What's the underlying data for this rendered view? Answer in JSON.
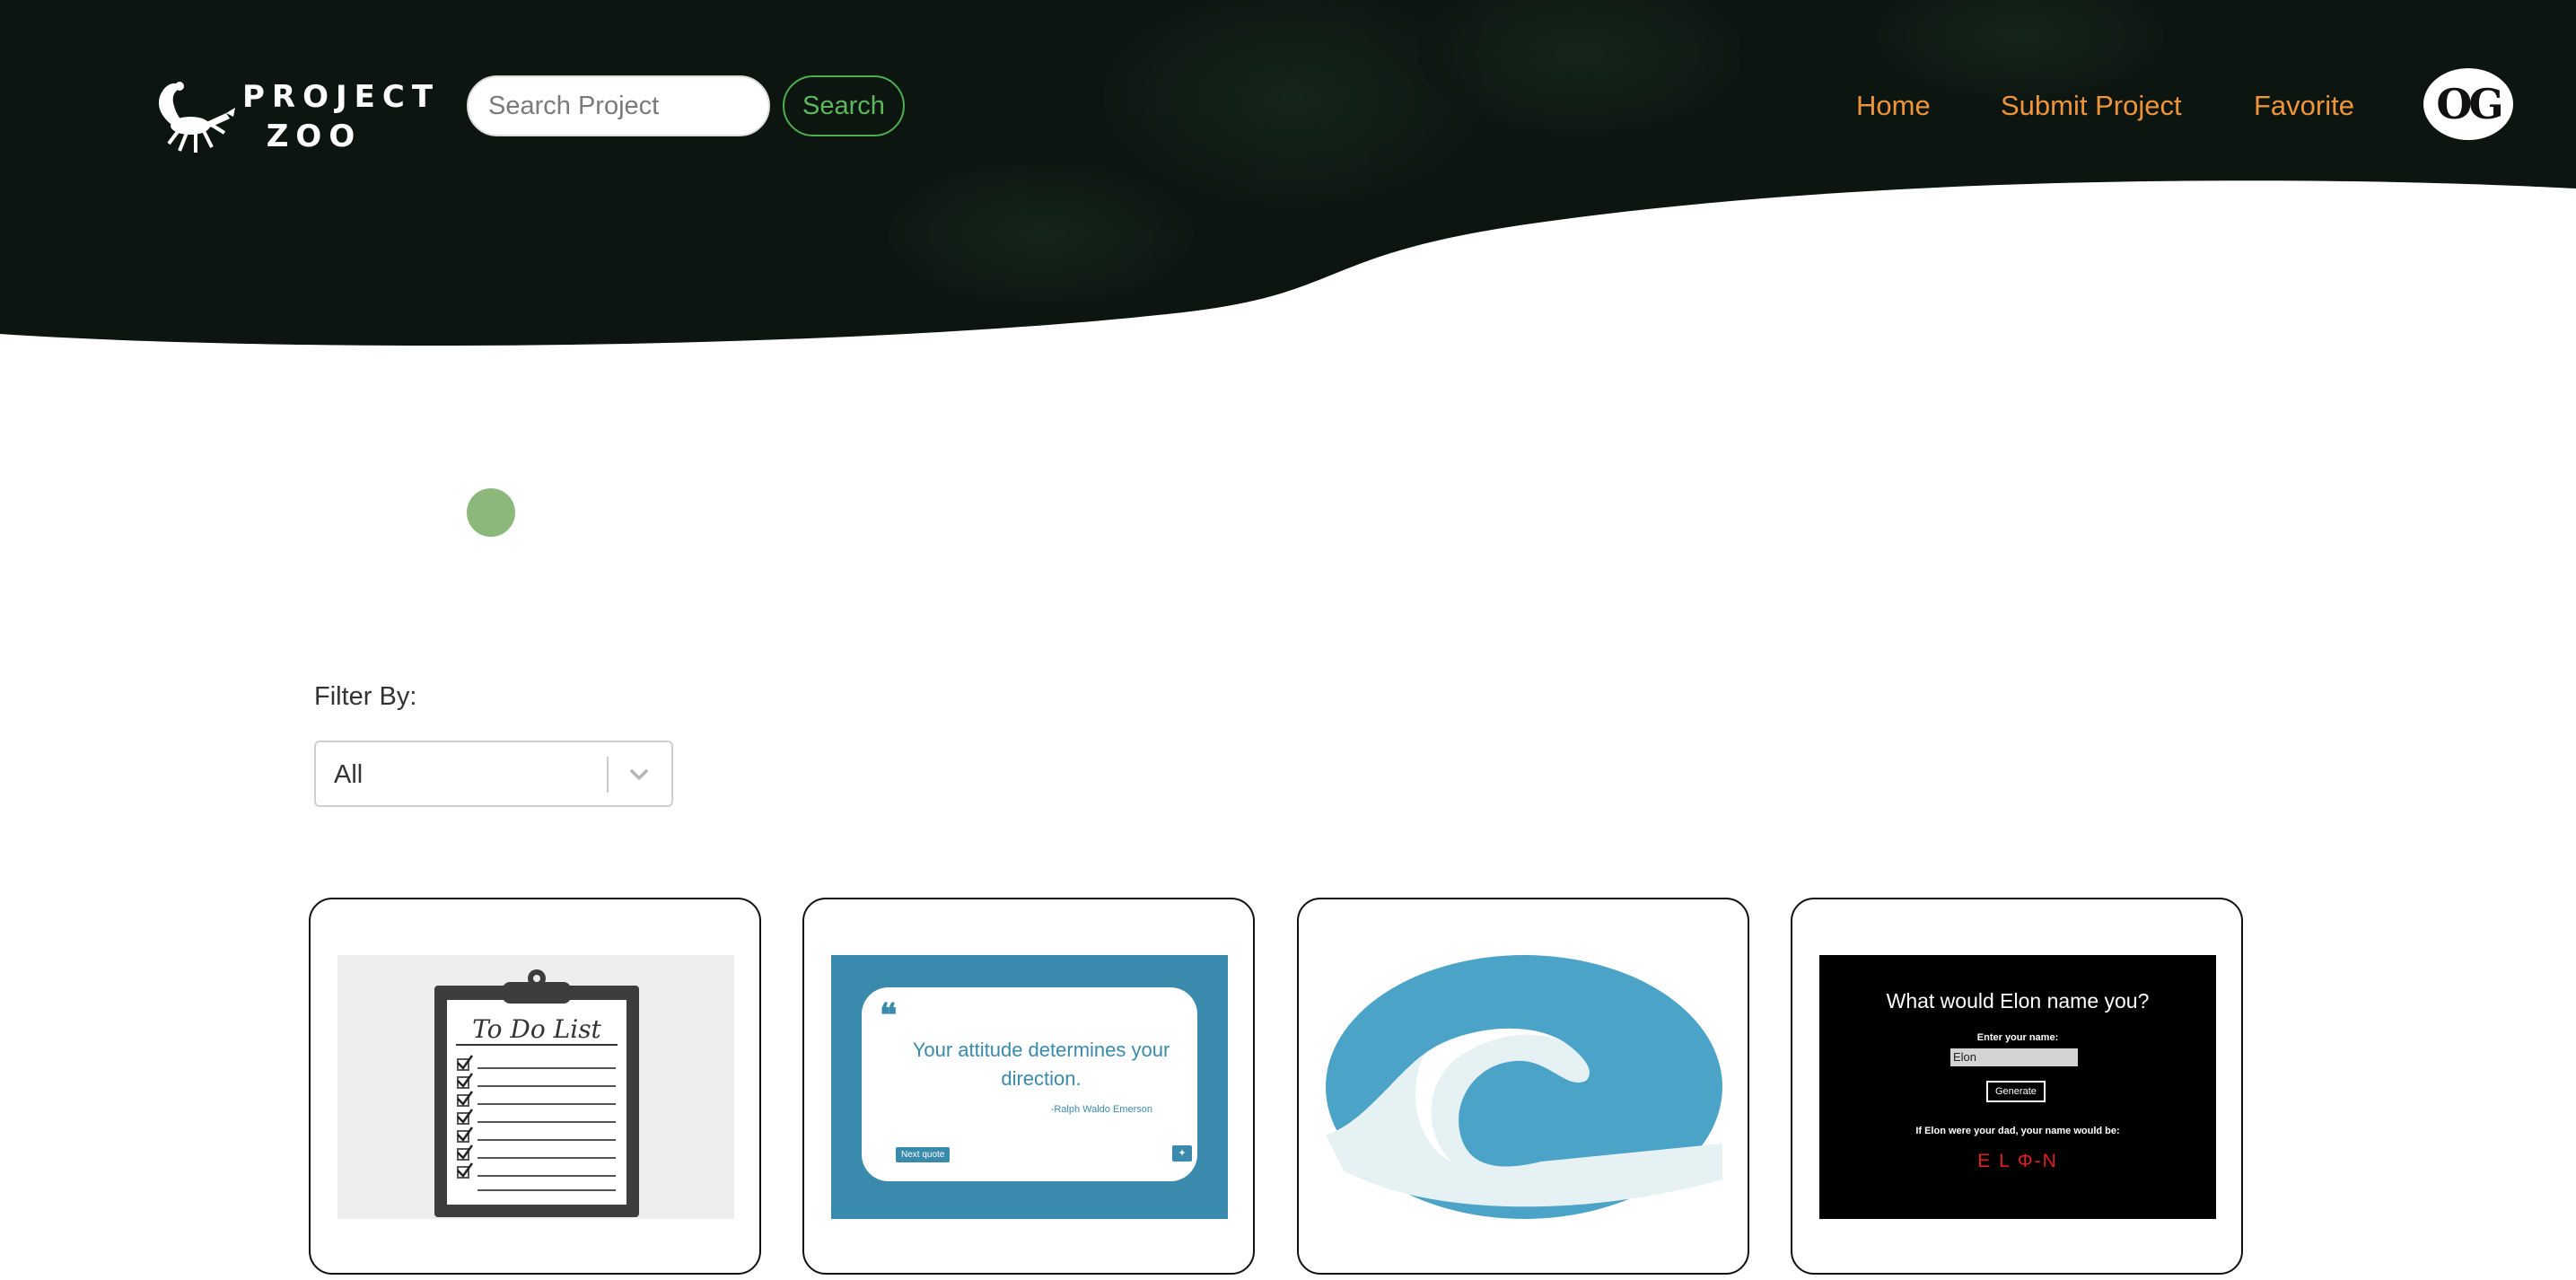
{
  "brand": {
    "line1": "PROJECT",
    "line2": "ZOO",
    "logo_icon": "scorpion-icon"
  },
  "search": {
    "placeholder": "Search Project",
    "value": "",
    "button_label": "Search"
  },
  "nav": {
    "home": "Home",
    "submit": "Submit Project",
    "favorite": "Favorite"
  },
  "avatar": {
    "initials": "OG"
  },
  "filter": {
    "label": "Filter By:",
    "selected": "All"
  },
  "colors": {
    "nav_link": "#f0943a",
    "search_accent": "#4caf50",
    "loader": "#8db87c",
    "hero_bg": "#0c1510"
  },
  "cards": [
    {
      "name": "todo-list",
      "title": "To Do List"
    },
    {
      "name": "quote-generator",
      "quote": "Your attitude determines your direction.",
      "author": "-Ralph Waldo Emerson",
      "button": "Next quote"
    },
    {
      "name": "c-logo"
    },
    {
      "name": "elon-name",
      "heading": "What would Elon name you?",
      "prompt": "Enter your name:",
      "input_value": "Elon",
      "button": "Generate",
      "result_label": "If Elon were your dad, your name would be:",
      "result": "E L Φ-N"
    }
  ]
}
